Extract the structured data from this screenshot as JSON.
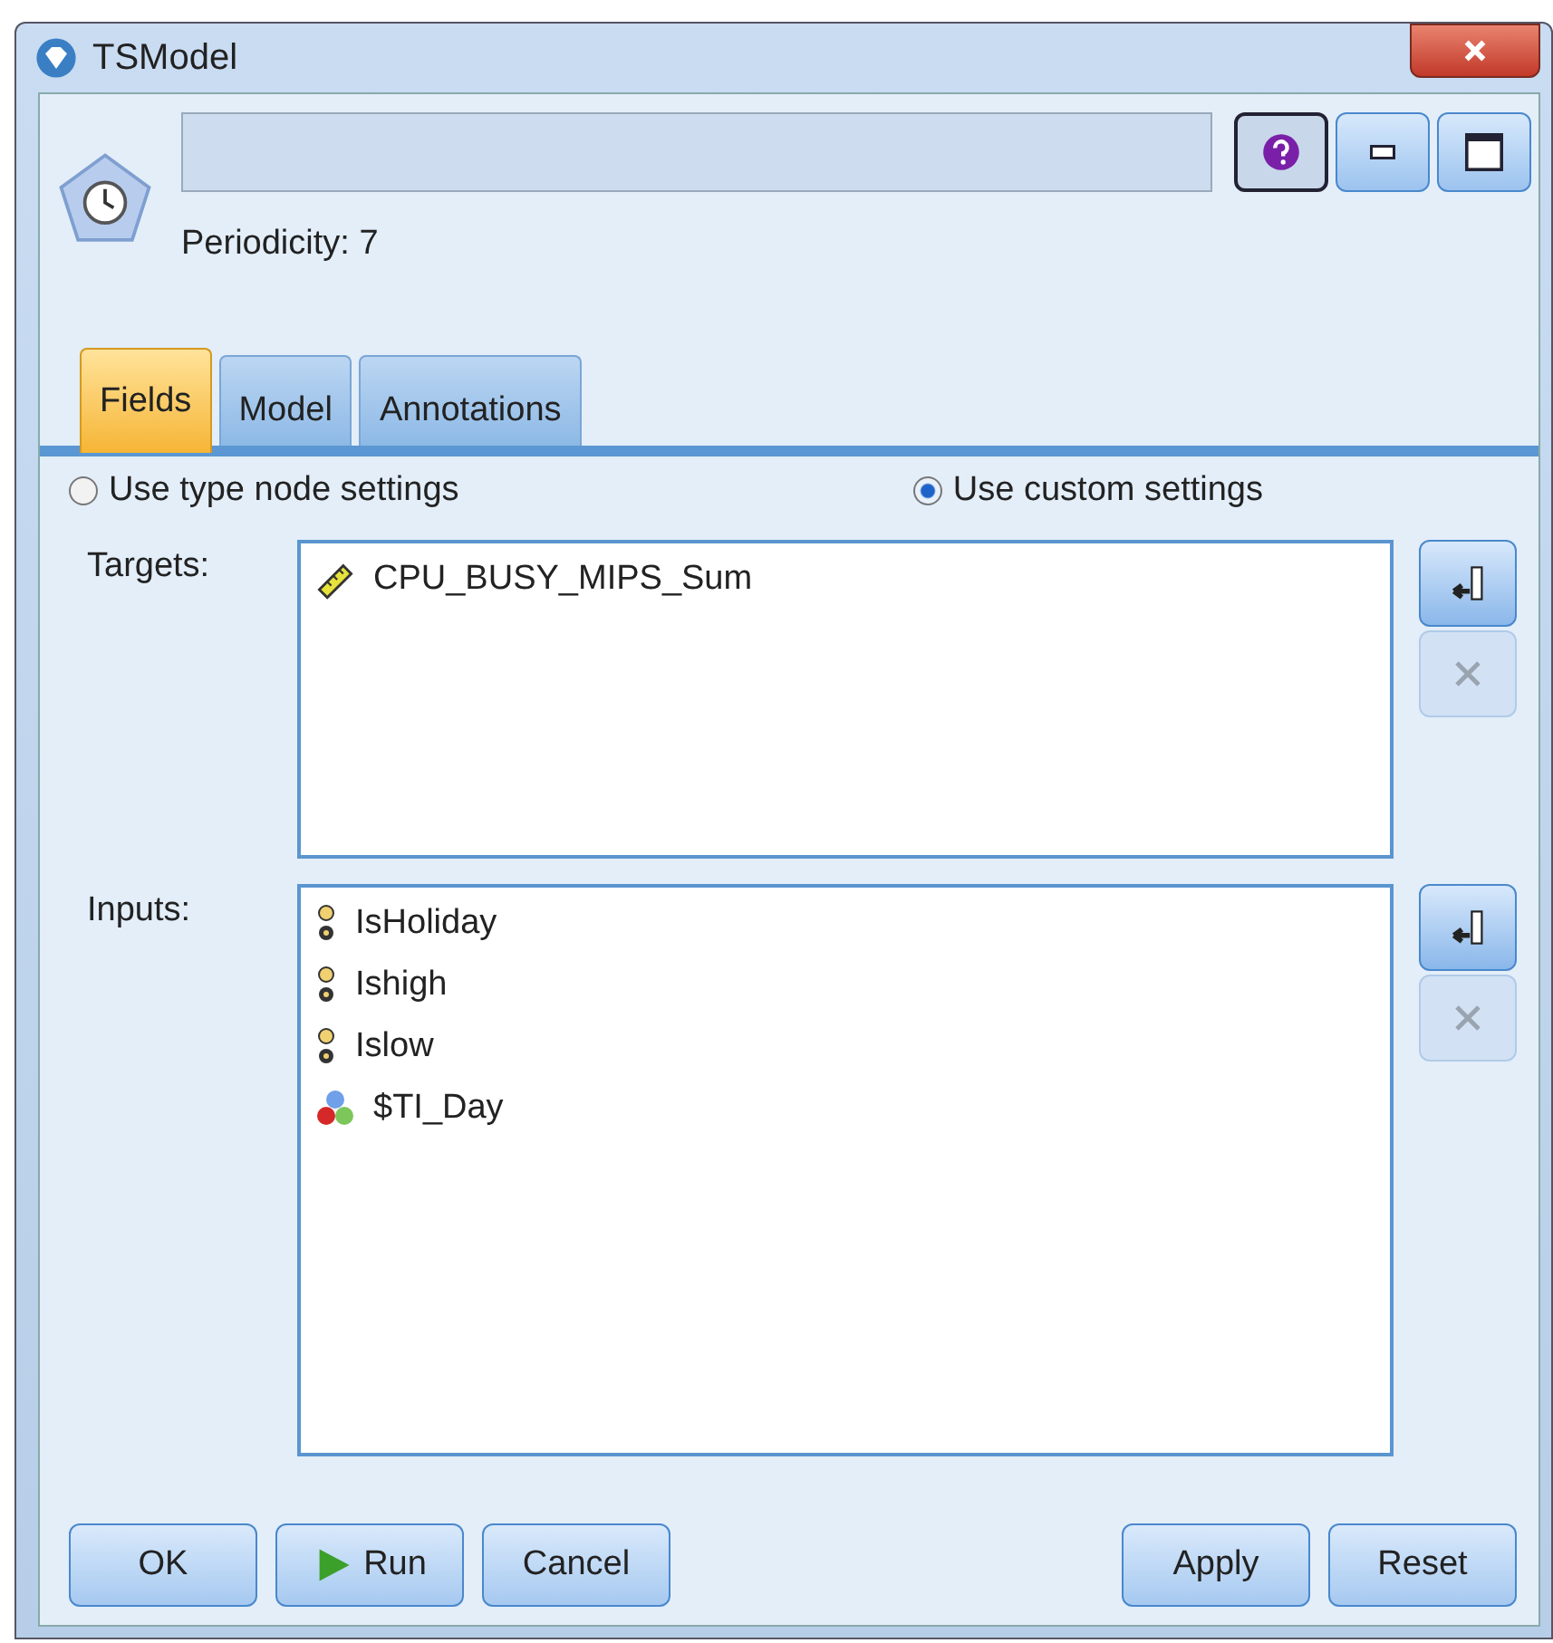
{
  "window": {
    "title": "TSModel"
  },
  "header": {
    "periodicity": "Periodicity: 7"
  },
  "tabs": [
    {
      "label": "Fields",
      "selected": true
    },
    {
      "label": "Model",
      "selected": false
    },
    {
      "label": "Annotations",
      "selected": false
    }
  ],
  "settings": [
    {
      "label": "Use type node settings",
      "selected": false
    },
    {
      "label": "Use custom settings",
      "selected": true
    }
  ],
  "targets": {
    "label": "Targets:",
    "fields": [
      {
        "name": "CPU_BUSY_MIPS_Sum",
        "kind": "continuous"
      }
    ]
  },
  "inputs": {
    "label": "Inputs:",
    "fields": [
      {
        "name": "IsHoliday",
        "kind": "flag"
      },
      {
        "name": "Ishigh",
        "kind": "flag"
      },
      {
        "name": "Islow",
        "kind": "flag"
      },
      {
        "name": "$TI_Day",
        "kind": "nominal"
      }
    ]
  },
  "buttons_left": [
    {
      "label": "OK",
      "kind": "plain"
    },
    {
      "label": "Run",
      "kind": "run"
    },
    {
      "label": "Cancel",
      "kind": "plain"
    }
  ],
  "buttons_right": [
    {
      "label": "Apply"
    },
    {
      "label": "Reset"
    }
  ]
}
